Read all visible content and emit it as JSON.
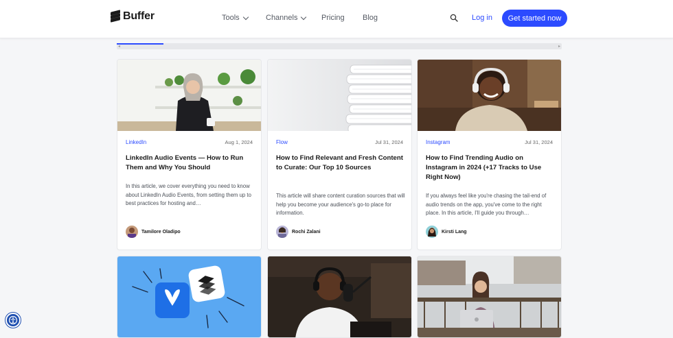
{
  "header": {
    "logo_text": "Buffer",
    "nav": [
      {
        "label": "Tools"
      },
      {
        "label": "Channels"
      },
      {
        "label": "Pricing"
      },
      {
        "label": "Blog"
      }
    ],
    "login_label": "Log in",
    "cta_label": "Get started now",
    "brand_color": "#2c4bff"
  },
  "cards": [
    {
      "category": "LinkedIn",
      "date": "Aug 1, 2024",
      "title": "LinkedIn Audio Events — How to Run Them and Why You Should",
      "excerpt": "In this article, we cover everything you need to know about LinkedIn Audio Events, from setting them up to best practices for hosting and…",
      "author": "Tamilore Oladipo"
    },
    {
      "category": "Flow",
      "date": "Jul 31, 2024",
      "title": "How to Find Relevant and Fresh Content to Curate: Our Top 10 Sources",
      "excerpt": "This article will share content curation sources that will help you become your audience's go-to place for information.",
      "author": "Rochi Zalani"
    },
    {
      "category": "Instagram",
      "date": "Jul 31, 2024",
      "title": "How to Find Trending Audio on Instagram in 2024 (+17 Tracks to Use Right Now)",
      "excerpt": "If you always feel like you're chasing the tail-end of audio trends on the app, you've come to the right place. In this article, I'll guide you through…",
      "author": "Kirsti Lang"
    }
  ],
  "icons": {
    "search": "search-icon",
    "accessibility": "accessibility-icon"
  }
}
